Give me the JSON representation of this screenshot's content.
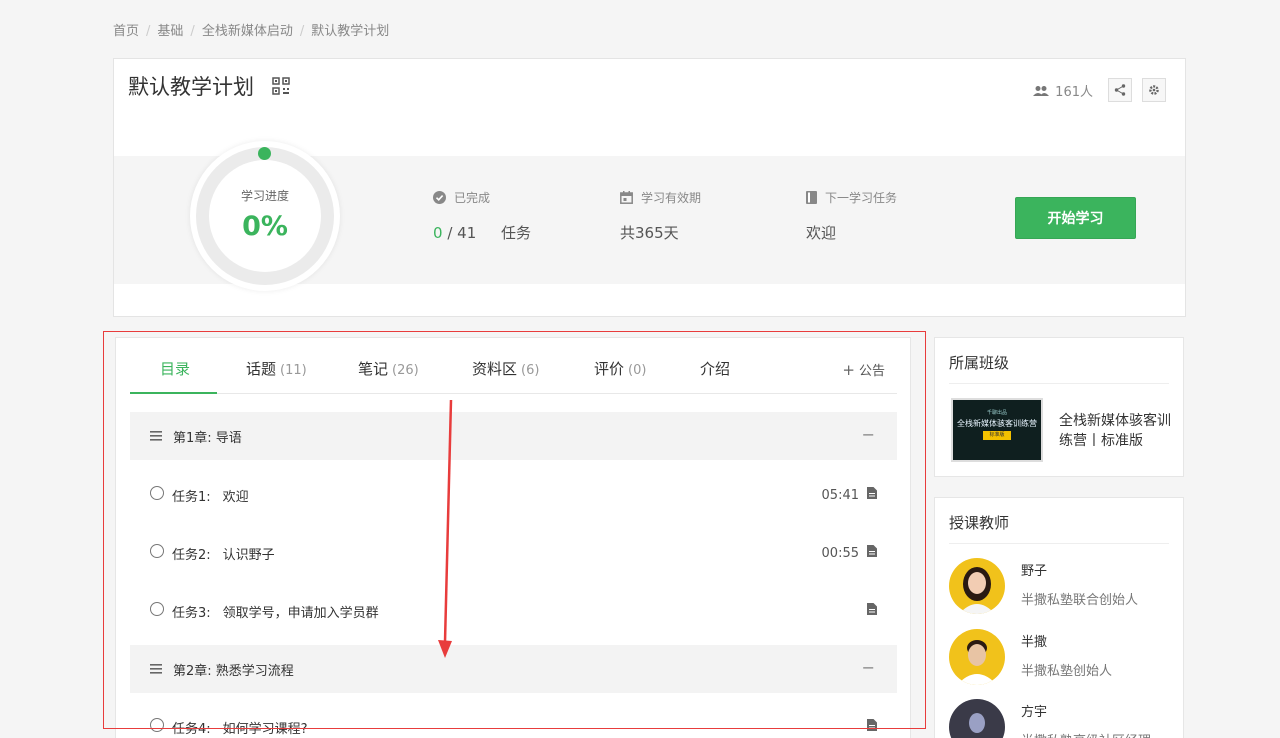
{
  "breadcrumb": [
    "首页",
    "基础",
    "全栈新媒体启动",
    "默认教学计划"
  ],
  "plan": {
    "title": "默认教学计划",
    "members": "161人"
  },
  "progress": {
    "label": "学习进度",
    "value": "0%",
    "fraction": 0
  },
  "stats": {
    "completed_label": "已完成",
    "completed_done": "0",
    "completed_total": "/ 41",
    "completed_unit": "任务",
    "validity_label": "学习有效期",
    "validity_value": "共365天",
    "next_label": "下一学习任务",
    "next_value": "欢迎"
  },
  "start_button": "开始学习",
  "tabs": [
    {
      "label": "目录",
      "count": ""
    },
    {
      "label": "话题",
      "count": "(11)"
    },
    {
      "label": "笔记",
      "count": "(26)"
    },
    {
      "label": "资料区",
      "count": "(6)"
    },
    {
      "label": "评价",
      "count": "(0)"
    },
    {
      "label": "介绍",
      "count": ""
    }
  ],
  "announce": "公告",
  "chapters": [
    {
      "title": "第1章: 导语",
      "collapse": "−"
    },
    {
      "title": "第2章: 熟悉学习流程",
      "collapse": "−"
    }
  ],
  "tasks": [
    {
      "num": "任务1:",
      "name": "欢迎",
      "duration": "05:41"
    },
    {
      "num": "任务2:",
      "name": "认识野子",
      "duration": "00:55"
    },
    {
      "num": "任务3:",
      "name": "领取学号，申请加入学员群",
      "duration": ""
    },
    {
      "num": "任务4:",
      "name": "如何学习课程?",
      "duration": ""
    }
  ],
  "sidebar": {
    "class_title": "所属班级",
    "class_name": "全栈新媒体骇客训练营丨标准版",
    "class_thumb_top": "千聊出品",
    "class_thumb_main": "全栈新媒体骇客训练营",
    "class_thumb_badge": "标准版",
    "teachers_title": "授课教师",
    "teachers": [
      {
        "name": "野子",
        "role": "半撒私塾联合创始人"
      },
      {
        "name": "半撒",
        "role": "半撒私塾创始人"
      },
      {
        "name": "方宇",
        "role": "半撒私塾高级社区经理"
      }
    ]
  },
  "colors": {
    "accent": "#3bb45d",
    "annotation": "#e83c3c"
  }
}
